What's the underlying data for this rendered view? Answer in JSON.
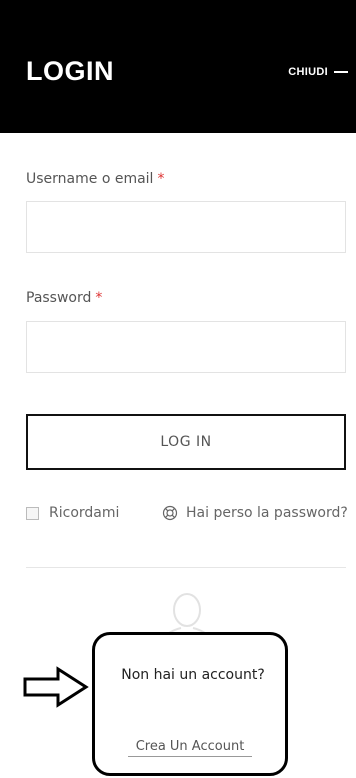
{
  "header": {
    "title": "LOGIN",
    "close_label": "CHIUDI"
  },
  "form": {
    "username_label": "Username o email",
    "password_label": "Password",
    "required_mark": "*",
    "username_value": "",
    "password_value": "",
    "login_button": "LOG IN",
    "remember_label": "Ricordami",
    "lost_password_label": "Hai perso la password?"
  },
  "register": {
    "question": "Non hai un account?",
    "link_label": "Crea Un Account"
  },
  "icons": {
    "lost_password": "lifebuoy-icon",
    "avatar": "user-silhouette-icon",
    "arrow": "arrow-right-icon"
  },
  "colors": {
    "header_bg": "#000000",
    "required": "#dd3333"
  }
}
